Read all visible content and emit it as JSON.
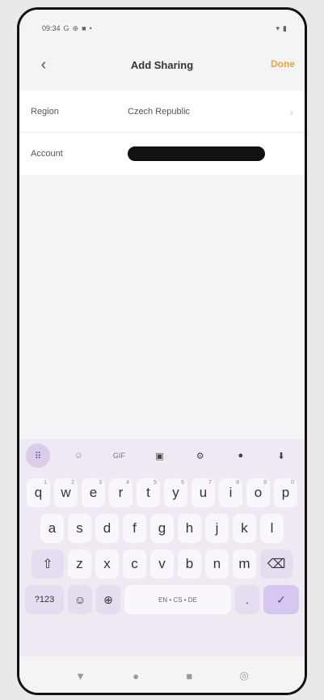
{
  "status": {
    "time": "09:34",
    "left_icons": [
      "G",
      "⊕",
      "■",
      "•"
    ],
    "right_icons": [
      "▾",
      "▮"
    ]
  },
  "header": {
    "back": "‹",
    "title": "Add Sharing",
    "done": "Done"
  },
  "form": {
    "region_label": "Region",
    "region_value": "Czech Republic",
    "account_label": "Account"
  },
  "keyboard": {
    "toolbar": {
      "apps_glyph": "⠿",
      "sticker_glyph": "☺",
      "gif_label": "GIF",
      "clipboard_glyph": "▣",
      "settings_glyph": "⚙",
      "palette_glyph": "●",
      "mic_glyph": "⬇"
    },
    "row1": [
      {
        "key": "q",
        "hint": "1"
      },
      {
        "key": "w",
        "hint": "2"
      },
      {
        "key": "e",
        "hint": "3"
      },
      {
        "key": "r",
        "hint": "4"
      },
      {
        "key": "t",
        "hint": "5"
      },
      {
        "key": "y",
        "hint": "6"
      },
      {
        "key": "u",
        "hint": "7"
      },
      {
        "key": "i",
        "hint": "8"
      },
      {
        "key": "o",
        "hint": "9"
      },
      {
        "key": "p",
        "hint": "0"
      }
    ],
    "row2": [
      "a",
      "s",
      "d",
      "f",
      "g",
      "h",
      "j",
      "k",
      "l"
    ],
    "row3": [
      "z",
      "x",
      "c",
      "v",
      "b",
      "n",
      "m"
    ],
    "shift_glyph": "⇧",
    "backspace_glyph": "⌫",
    "num_key": "?123",
    "emoji_glyph": "☺",
    "globe_glyph": "⊕",
    "space_label": "EN • CS • DE",
    "period": ".",
    "enter_glyph": "✓"
  },
  "system_nav": {
    "back_glyph": "▼",
    "home_glyph": "●",
    "recents_glyph": "■",
    "accessibility_glyph": "◎"
  }
}
